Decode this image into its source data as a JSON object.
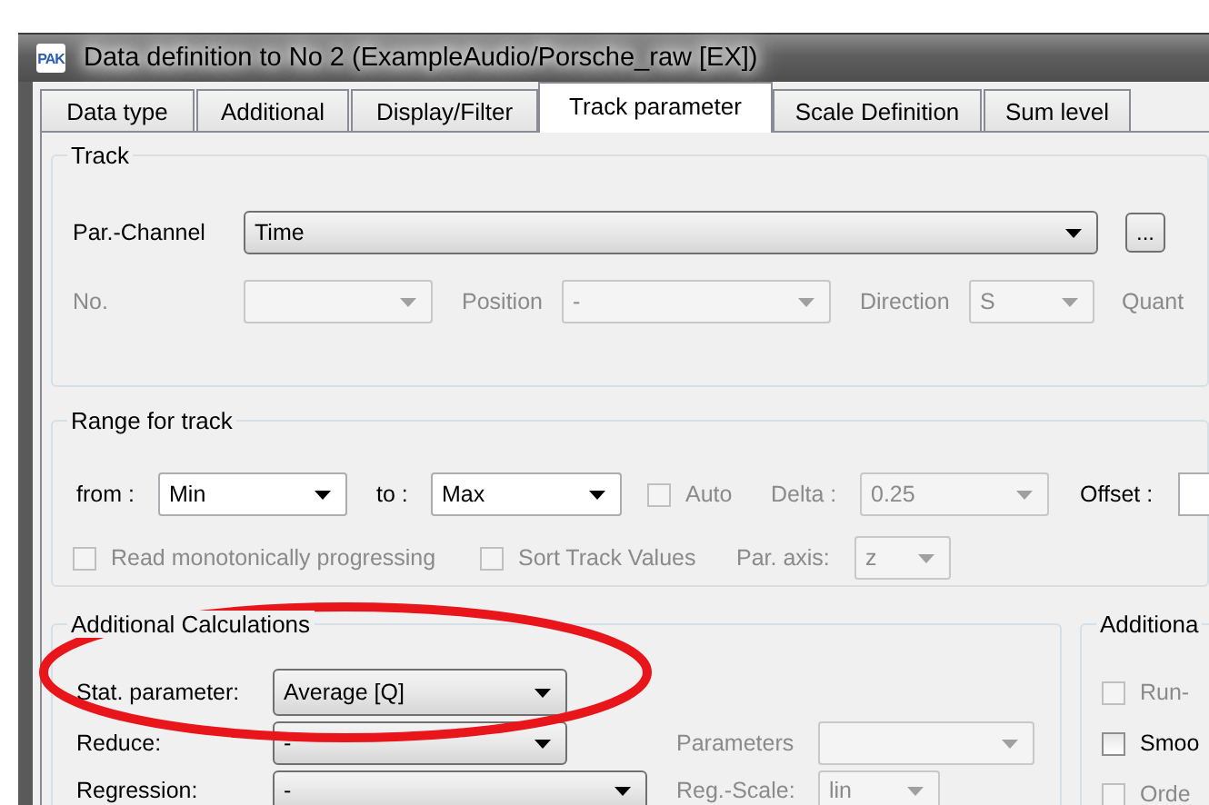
{
  "window": {
    "icon_text": "PAK",
    "title": "Data definition to No 2 (ExampleAudio/Porsche_raw [EX])"
  },
  "tabs": [
    {
      "label": "Data type",
      "selected": false
    },
    {
      "label": "Additional",
      "selected": false
    },
    {
      "label": "Display/Filter",
      "selected": false
    },
    {
      "label": "Track parameter",
      "selected": true
    },
    {
      "label": "Scale Definition",
      "selected": false
    },
    {
      "label": "Sum level",
      "selected": false
    }
  ],
  "groups": [
    {
      "title": "Track",
      "controls": [
        {
          "kind": "label",
          "text": "Par.-Channel",
          "disabled": false
        },
        {
          "kind": "dropdown",
          "value": "Time",
          "disabled": false
        },
        {
          "kind": "button",
          "text": "..."
        },
        {
          "kind": "label",
          "text": "No.",
          "disabled": true
        },
        {
          "kind": "combobox",
          "disabled": true
        },
        {
          "kind": "label",
          "text": "Position",
          "disabled": true
        },
        {
          "kind": "combobox",
          "value": "-",
          "disabled": true
        },
        {
          "kind": "label",
          "text": "Direction",
          "disabled": true
        },
        {
          "kind": "combobox",
          "value": "S",
          "disabled": true
        },
        {
          "kind": "label",
          "text": "Quant",
          "disabled": true
        }
      ]
    },
    {
      "title": "Range for track",
      "controls": [
        {
          "kind": "label",
          "text": "from :",
          "disabled": false
        },
        {
          "kind": "combobox",
          "value": "Min",
          "disabled": false
        },
        {
          "kind": "label",
          "text": "to :",
          "disabled": false
        },
        {
          "kind": "combobox",
          "value": "Max",
          "disabled": false
        },
        {
          "kind": "checkbox",
          "text": "Auto",
          "checked": false,
          "disabled": true
        },
        {
          "kind": "label",
          "text": "Delta :",
          "disabled": true
        },
        {
          "kind": "combobox",
          "value": "0.25",
          "disabled": true
        },
        {
          "kind": "label",
          "text": "Offset :",
          "disabled": false
        },
        {
          "kind": "field"
        },
        {
          "kind": "checkbox",
          "text": "Read monotonically progressing",
          "checked": false,
          "disabled": true
        },
        {
          "kind": "checkbox",
          "text": "Sort Track Values",
          "checked": false,
          "disabled": true
        },
        {
          "kind": "label",
          "text": "Par. axis:",
          "disabled": true
        },
        {
          "kind": "combobox",
          "value": "z",
          "disabled": true
        }
      ]
    },
    {
      "title": "Additional Calculations",
      "controls": [
        {
          "kind": "label",
          "text": "Stat. parameter:",
          "disabled": false
        },
        {
          "kind": "dropdown",
          "value": "Average [Q]",
          "disabled": false
        },
        {
          "kind": "label",
          "text": "Reduce:",
          "disabled": false
        },
        {
          "kind": "dropdown",
          "value": "-",
          "disabled": false
        },
        {
          "kind": "label",
          "text": "Parameters",
          "disabled": true
        },
        {
          "kind": "combobox",
          "disabled": true
        },
        {
          "kind": "label",
          "text": "Regression:",
          "disabled": false
        },
        {
          "kind": "dropdown",
          "value": "-",
          "disabled": false
        },
        {
          "kind": "label",
          "text": "Reg.-Scale:",
          "disabled": true
        },
        {
          "kind": "combobox",
          "value": "lin",
          "disabled": true
        }
      ]
    },
    {
      "title": "Additiona",
      "controls": [
        {
          "kind": "checkbox",
          "text": "Run-",
          "checked": false,
          "disabled": true
        },
        {
          "kind": "checkbox",
          "text": "Smoo",
          "checked": false,
          "disabled": false
        },
        {
          "kind": "checkbox",
          "text": "Orde",
          "checked": false,
          "disabled": true
        }
      ]
    }
  ]
}
